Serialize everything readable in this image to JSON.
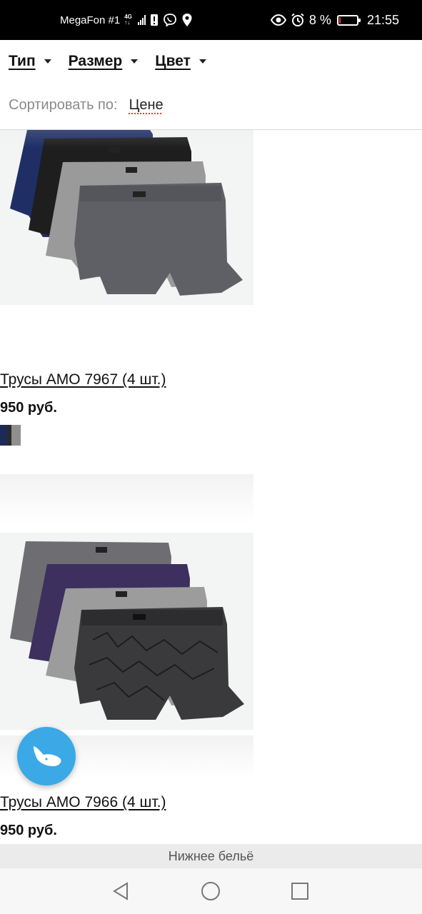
{
  "status_bar": {
    "carrier": "MegaFon #1",
    "network": "4G",
    "battery_percent": "8 %",
    "battery_level": 0.08,
    "time": "21:55"
  },
  "filters": {
    "type_label": "Тип",
    "size_label": "Размер",
    "color_label": "Цвет",
    "sort_label": "Сортировать по:",
    "sort_value": "Цене"
  },
  "products": [
    {
      "title": "Трусы AMO 7967 (4 шт.)",
      "price": "950 руб.",
      "colors": [
        "#1f2f66",
        "#1e1e1e",
        "#9a9a9a",
        "#5f6066"
      ]
    },
    {
      "title": "Трусы AMO 7966 (4 шт.)",
      "price": "950 руб.",
      "colors": [
        "#6e6e72",
        "#3d2f5e",
        "#9c9c9c",
        "#3a3a3c"
      ]
    }
  ],
  "bottom_label": "Нижнее бельё",
  "colors": {
    "fab": "#3aa9e6",
    "battery_low": "#e53935"
  }
}
